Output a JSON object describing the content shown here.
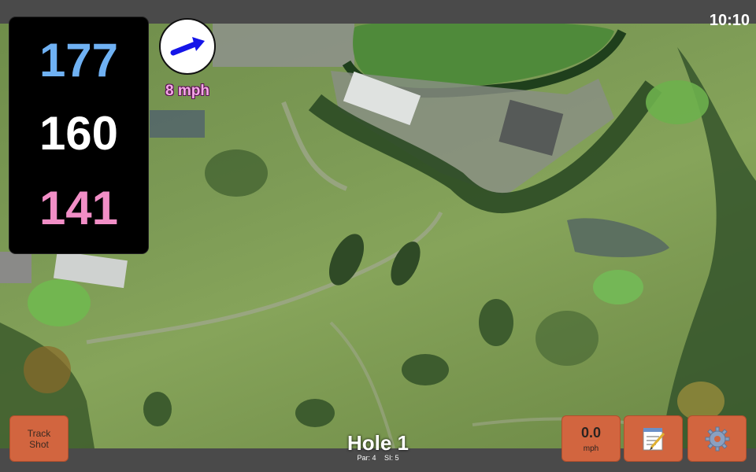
{
  "status": {
    "time": "10:10"
  },
  "distances": {
    "back": "177",
    "middle": "160",
    "front": "141"
  },
  "wind": {
    "speed": "8 mph",
    "direction_icon": "wind-arrow-icon"
  },
  "buttons": {
    "track_shot_line1": "Track",
    "track_shot_line2": "Shot",
    "speed_value": "0.0",
    "speed_unit": "mph",
    "notes_icon": "notepad-icon",
    "settings_icon": "gear-icon"
  },
  "hole": {
    "title": "Hole 1",
    "par": "Par: 4",
    "si": "SI: 5"
  },
  "colors": {
    "back": "#6fb1f3",
    "middle": "#ffffff",
    "front": "#f18ec6",
    "button": "#d2653f"
  }
}
